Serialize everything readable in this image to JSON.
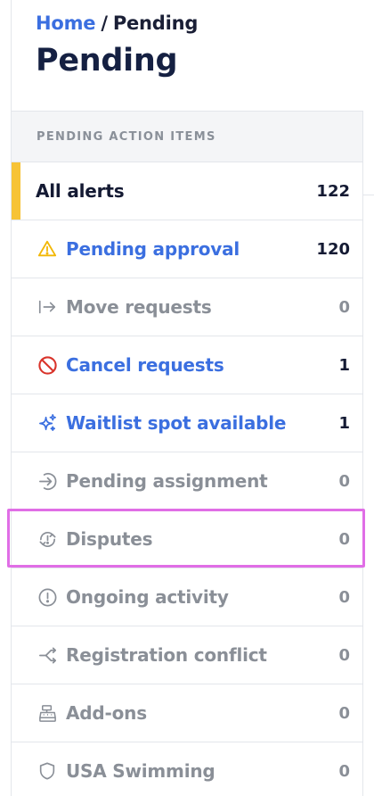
{
  "breadcrumb": {
    "home": "Home",
    "separator": "/",
    "current": "Pending"
  },
  "page_title": "Pending",
  "panel": {
    "header": "PENDING ACTION ITEMS",
    "items": [
      {
        "label": "All alerts",
        "count": "122",
        "icon": "none",
        "tone": "active"
      },
      {
        "label": "Pending approval",
        "count": "120",
        "icon": "warning-triangle-icon",
        "tone": "blue"
      },
      {
        "label": "Move requests",
        "count": "0",
        "icon": "move-arrow-icon",
        "tone": "gray"
      },
      {
        "label": "Cancel requests",
        "count": "1",
        "icon": "prohibited-icon",
        "tone": "blue"
      },
      {
        "label": "Waitlist spot available",
        "count": "1",
        "icon": "sparkle-icon",
        "tone": "blue"
      },
      {
        "label": "Pending assignment",
        "count": "0",
        "icon": "arrow-right-circle-icon",
        "tone": "gray"
      },
      {
        "label": "Disputes",
        "count": "0",
        "icon": "dispute-cycle-icon",
        "tone": "gray"
      },
      {
        "label": "Ongoing activity",
        "count": "0",
        "icon": "exclamation-circle-icon",
        "tone": "gray"
      },
      {
        "label": "Registration conflict",
        "count": "0",
        "icon": "conflict-arrows-icon",
        "tone": "gray"
      },
      {
        "label": "Add-ons",
        "count": "0",
        "icon": "cash-register-icon",
        "tone": "gray"
      },
      {
        "label": "USA Swimming",
        "count": "0",
        "icon": "shield-icon",
        "tone": "gray"
      }
    ]
  },
  "colors": {
    "link_blue": "#3b6fe0",
    "active_accent": "#f7c336",
    "warning_yellow": "#f2b705",
    "prohibited_red": "#d9342b",
    "muted_gray": "#8a8f97",
    "highlight_magenta": "#e06ee6"
  }
}
